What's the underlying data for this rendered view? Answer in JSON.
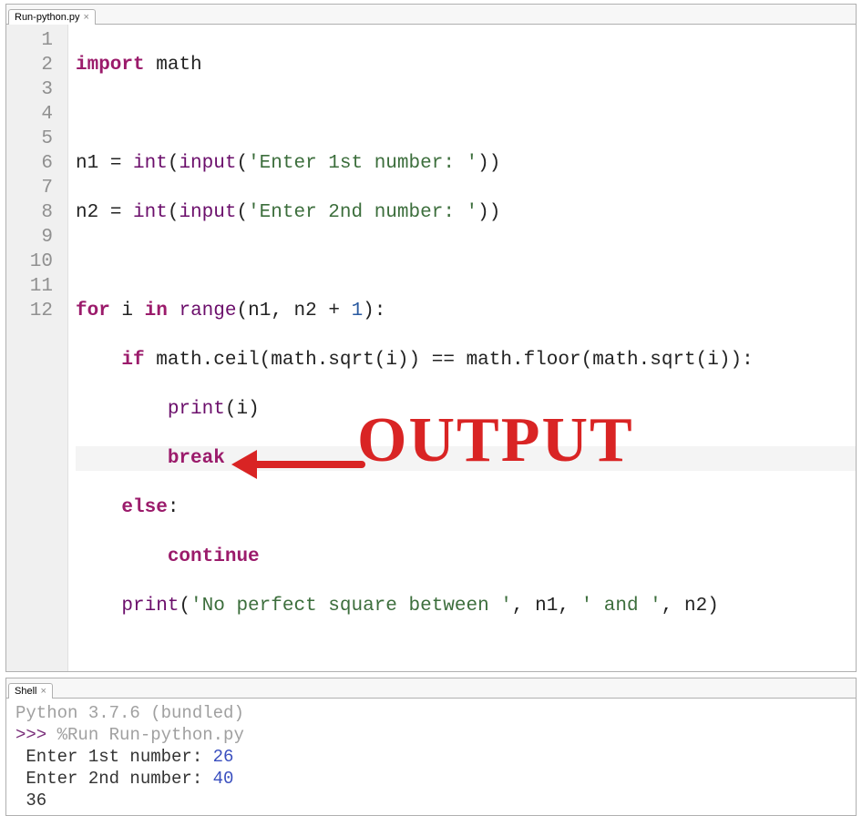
{
  "editor": {
    "tab_label": "Run-python.py",
    "lines": [
      "1",
      "2",
      "3",
      "4",
      "5",
      "6",
      "7",
      "8",
      "9",
      "10",
      "11",
      "12"
    ],
    "code": {
      "import_kw": "import",
      "math": "math",
      "n1": "n1",
      "n2": "n2",
      "eq": " = ",
      "int": "int",
      "input": "input",
      "str_enter1": "'Enter 1st number: '",
      "str_enter2": "'Enter 2nd number: '",
      "for_kw": "for",
      "i": "i",
      "in_kw": "in",
      "range": "range",
      "comma_sp": ", ",
      "plus": " + ",
      "one": "1",
      "colon": ":",
      "if_kw": "if",
      "ceil": "math.ceil",
      "sqrt": "math.sqrt",
      "floor": "math.floor",
      "eqeq": " == ",
      "print": "print",
      "break_kw": "break",
      "else_kw": "else",
      "continue_kw": "continue",
      "str_noperf": "'No perfect square between '",
      "str_and": "' and '"
    }
  },
  "shell": {
    "tab_label": "Shell",
    "version": "Python 3.7.6 (bundled)",
    "prompt": ">>>",
    "run_cmd": "%Run Run-python.py",
    "line1_label": "Enter 1st number: ",
    "line1_val": "26",
    "line2_label": "Enter 2nd number: ",
    "line2_val": "40",
    "result": "36"
  },
  "annotation": {
    "text": "OUTPUT"
  }
}
